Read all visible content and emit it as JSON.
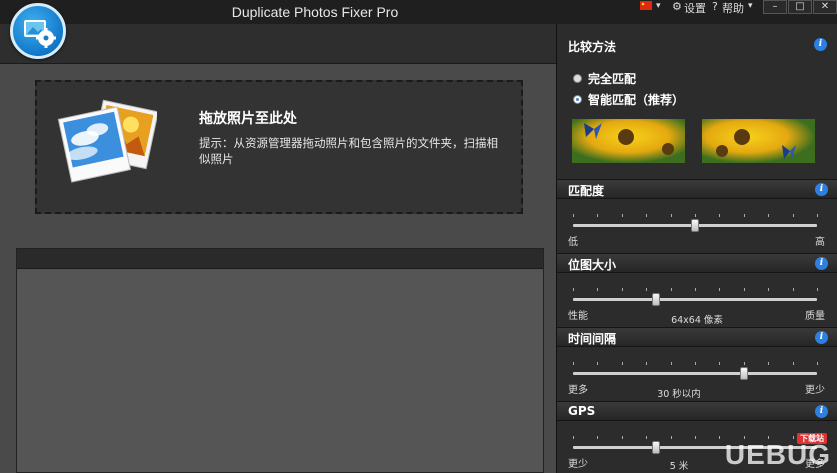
{
  "app": {
    "title": "Duplicate Photos Fixer Pro"
  },
  "titlebar": {
    "settings_label": "设置",
    "help_label": "帮助",
    "minimize": "–",
    "maximize": "□",
    "close": "✕"
  },
  "dropzone": {
    "title": "拖放照片至此处",
    "hint": "提示：从资源管理器拖动照片和包含照片的文件夹，扫描相似照片"
  },
  "panel": {
    "compare_method": {
      "title": "比较方法",
      "options": [
        {
          "label": "完全匹配",
          "selected": false
        },
        {
          "label": "智能匹配（推荐）",
          "selected": true
        }
      ]
    },
    "match_level": {
      "title": "匹配度",
      "low": "低",
      "high": "高",
      "value_fraction": 0.5
    },
    "bitmap_size": {
      "title": "位图大小",
      "left": "性能",
      "right": "质量",
      "value": "64x64 像素",
      "value_fraction": 0.34
    },
    "time_interval": {
      "title": "时间间隔",
      "left": "更多",
      "right": "更少",
      "value": "30 秒以内",
      "value_fraction": 0.7
    },
    "gps": {
      "title": "GPS",
      "left": "更少",
      "right": "更多",
      "value": "5 米",
      "value_fraction": 0.34
    }
  },
  "watermark": {
    "text": "UEBUG",
    "badge": "下载站"
  },
  "colors": {
    "accent": "#2d7fe0",
    "panel_bg": "#2c2c2c",
    "main_bg": "#4a4a4a"
  }
}
